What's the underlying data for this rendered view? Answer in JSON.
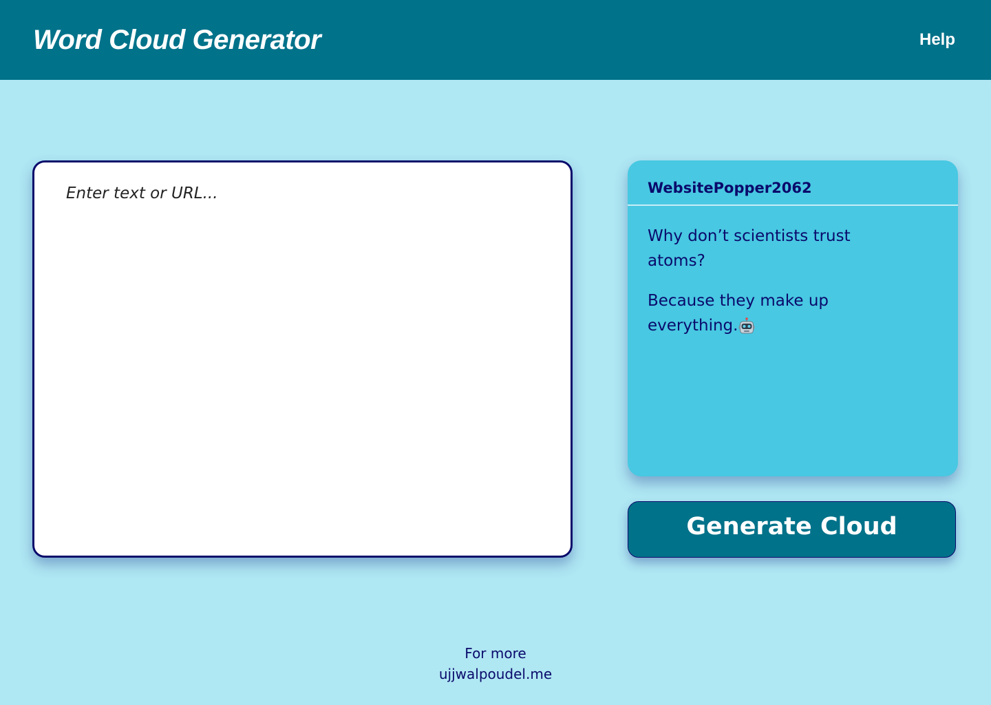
{
  "header": {
    "title": "Word Cloud Generator",
    "help_label": "Help"
  },
  "input": {
    "placeholder": "Enter text or URL...",
    "value": ""
  },
  "joke_card": {
    "username": "WebsitePopper2062",
    "question": "Why don’t scientists trust atoms?",
    "answer": "Because they make up everything.",
    "answer_icon": "robot-face-emoji"
  },
  "actions": {
    "generate_label": "Generate Cloud"
  },
  "footer": {
    "line1": "For more",
    "link": "ujjwalpoudel.me"
  },
  "colors": {
    "background": "#afe7f3",
    "header": "#00728a",
    "card": "#48c8e2",
    "text_dark": "#0a0a6b",
    "button": "#00728a"
  }
}
